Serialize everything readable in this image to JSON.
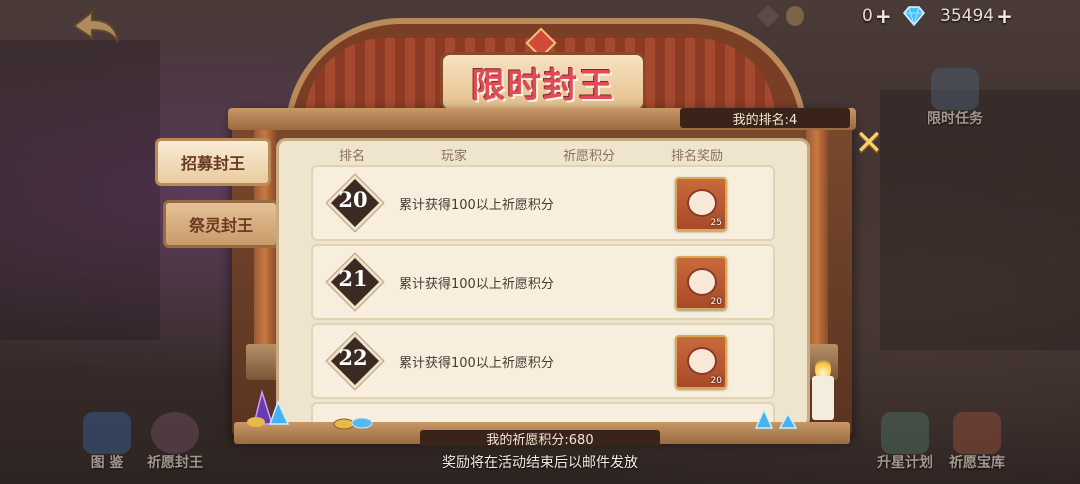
{
  "title": "限时封王",
  "resources": {
    "item_count": "0",
    "diamonds": "35494"
  },
  "tabs": [
    {
      "label": "招募封王"
    },
    {
      "label": "祭灵封王"
    }
  ],
  "my_rank": "我的排名:4",
  "table": {
    "headers": [
      "排名",
      "玩家",
      "祈愿积分",
      "排名奖励"
    ],
    "rows": [
      {
        "rank": "20",
        "desc": "累计获得100以上祈愿积分",
        "reward_count": "25"
      },
      {
        "rank": "21",
        "desc": "累计获得100以上祈愿积分",
        "reward_count": "20"
      },
      {
        "rank": "22",
        "desc": "累计获得100以上祈愿积分",
        "reward_count": "20"
      }
    ]
  },
  "my_score": "我的祈愿积分:680",
  "mail_note": "奖励将在活动结束后以邮件发放",
  "side_menu": {
    "left": [
      {
        "label": "图 鉴",
        "icon": "book-icon"
      },
      {
        "label": "祈愿封王",
        "icon": "crown-icon"
      }
    ],
    "right": [
      {
        "label": "限时任务",
        "icon": "task-icon"
      },
      {
        "label": "升星计划",
        "icon": "star-up-icon"
      },
      {
        "label": "祈愿宝库",
        "icon": "treasure-icon"
      }
    ]
  },
  "colors": {
    "title": "#e24a5a",
    "panel": "#efe5cf",
    "frame": "#7a4a2e",
    "close": "#f8d070"
  }
}
